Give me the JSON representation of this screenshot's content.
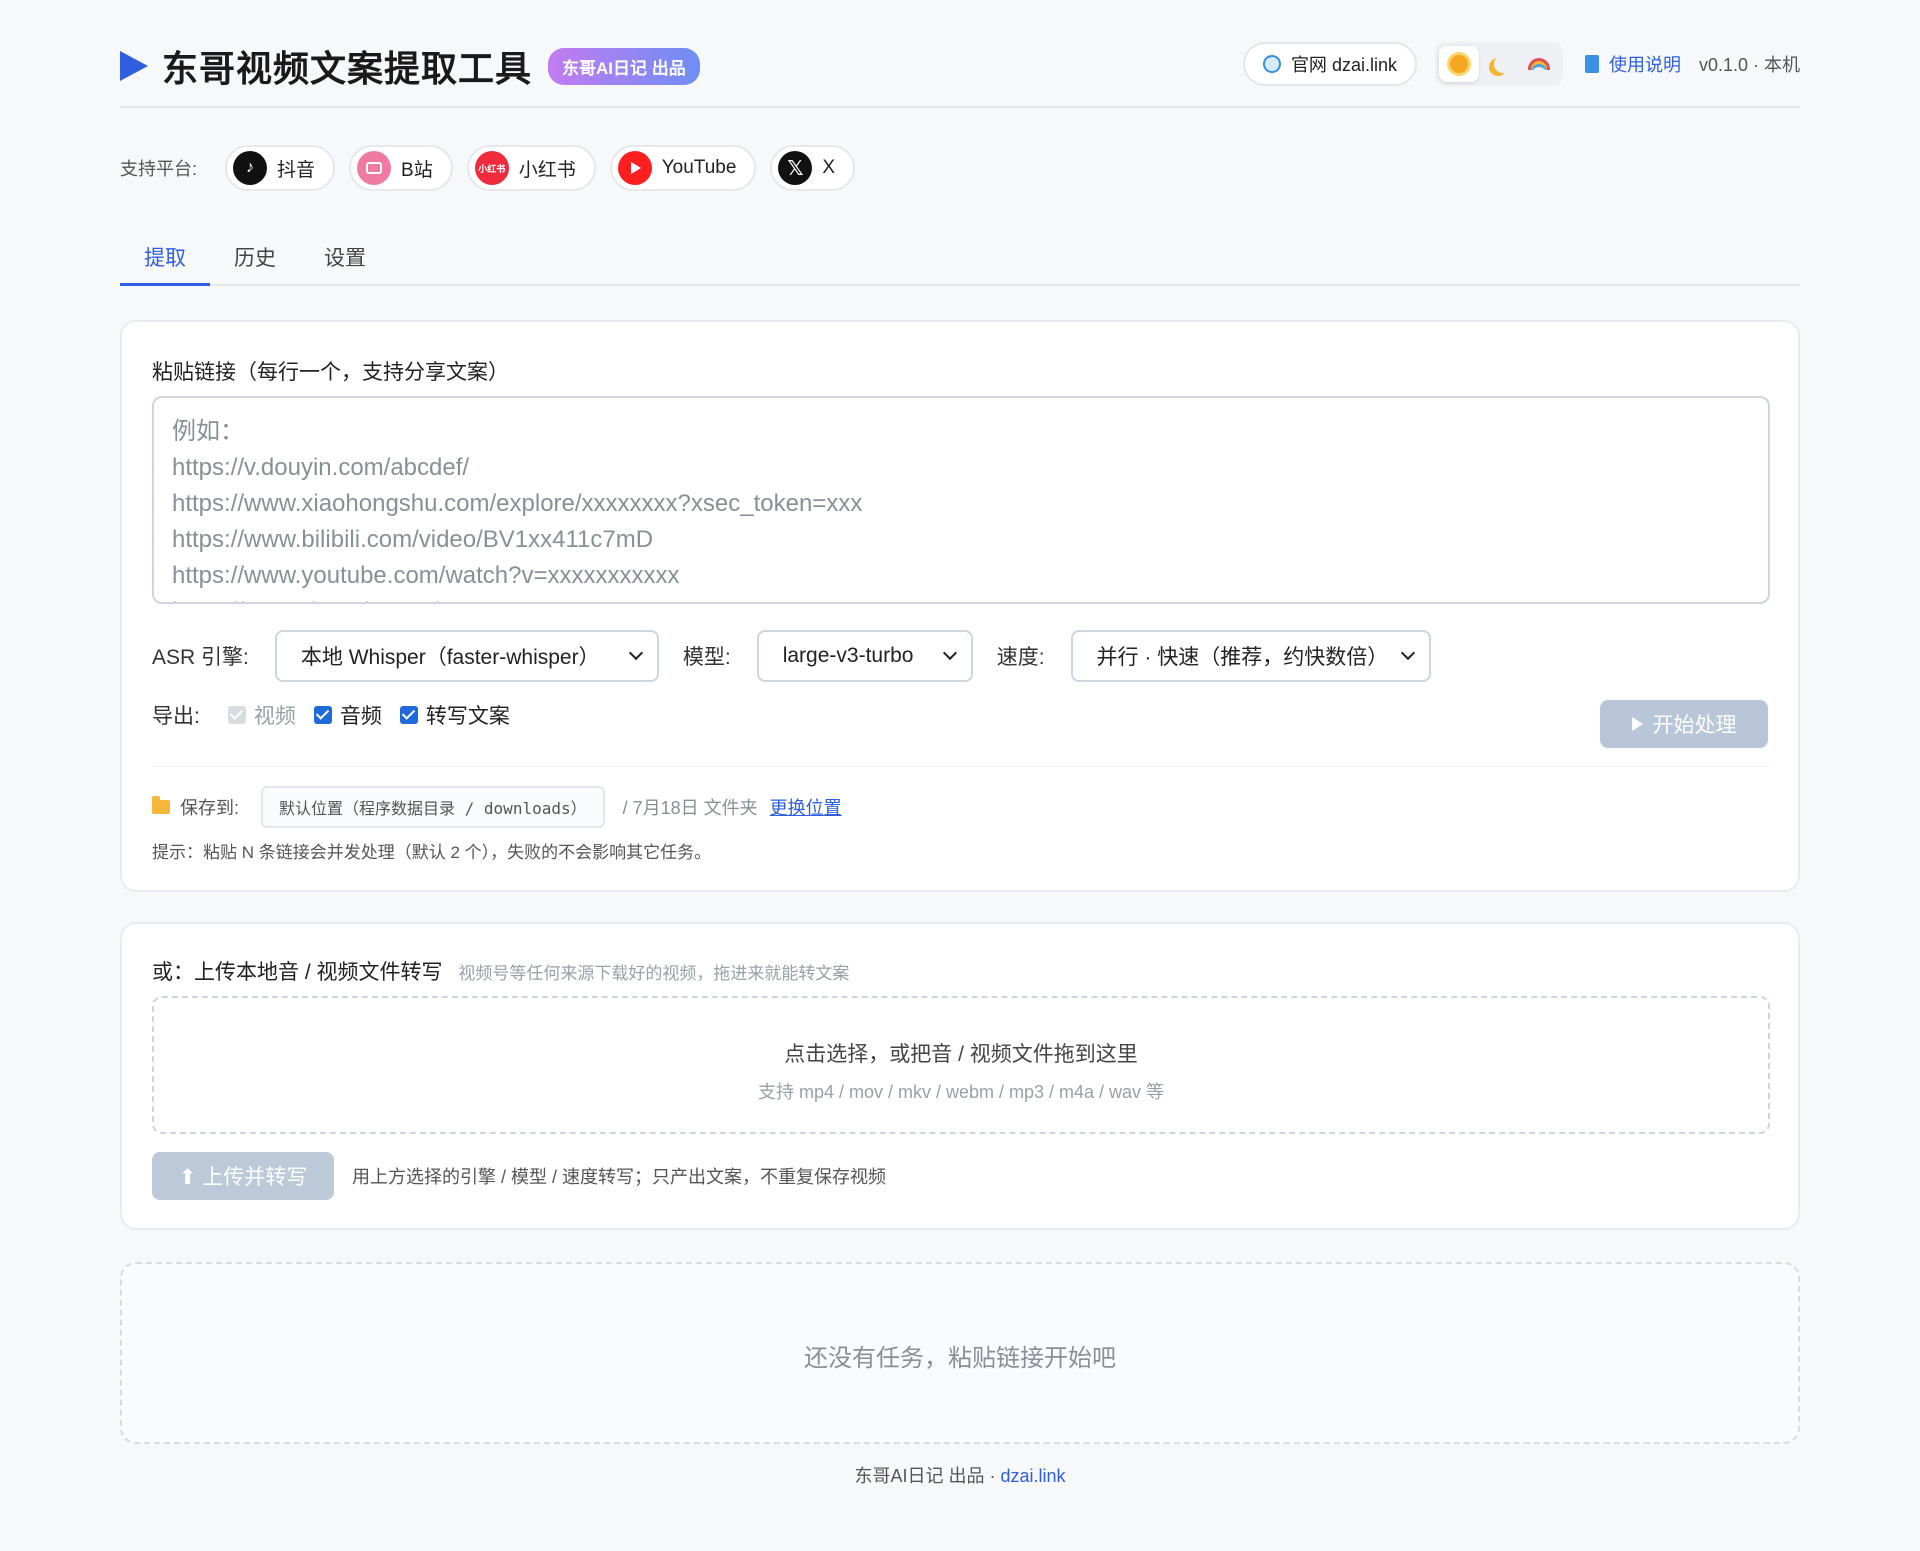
{
  "header": {
    "title": "东哥视频文案提取工具",
    "badge": "东哥AI日记 出品",
    "site_link": "官网 dzai.link",
    "doc_link": "使用说明",
    "version": "v0.1.0 · 本机",
    "theme_icons": [
      "sun-icon",
      "moon-icon",
      "rainbow-icon"
    ]
  },
  "platforms": {
    "label": "支持平台:",
    "items": [
      {
        "name": "抖音",
        "icon": "douyin-icon"
      },
      {
        "name": "B站",
        "icon": "bilibili-icon"
      },
      {
        "name": "小红书",
        "icon": "xiaohongshu-icon",
        "icon_text": "小红书"
      },
      {
        "name": "YouTube",
        "icon": "youtube-icon"
      },
      {
        "name": "X",
        "icon": "x-icon",
        "icon_text": "𝕏"
      }
    ]
  },
  "tabs": [
    "提取",
    "历史",
    "设置"
  ],
  "extract": {
    "title": "粘贴链接（每行一个，支持分享文案）",
    "placeholder": "例如：\nhttps://v.douyin.com/abcdef/\nhttps://www.xiaohongshu.com/explore/xxxxxxxx?xsec_token=xxx\nhttps://www.bilibili.com/video/BV1xx411c7mD\nhttps://www.youtube.com/watch?v=xxxxxxxxxxx\nhttps://x.com/user/status/xxx",
    "asr_label": "ASR 引擎:",
    "asr_value": "本地 Whisper（faster-whisper）",
    "model_label": "模型:",
    "model_value": "large-v3-turbo",
    "speed_label": "速度:",
    "speed_value": "并行 · 快速（推荐，约快数倍）",
    "export_label": "导出:",
    "export_video": "视频",
    "export_audio": "音频",
    "export_text": "转写文案",
    "start_button": "开始处理",
    "save_label": "保存到:",
    "save_path": "默认位置（程序数据目录 / downloads）",
    "save_sub": "/ 7月18日 文件夹",
    "change_location": "更换位置",
    "tip": "提示：粘贴 N 条链接会并发处理（默认 2 个），失败的不会影响其它任务。"
  },
  "upload": {
    "title": "或：上传本地音 / 视频文件转写",
    "subtitle": "视频号等任何来源下载好的视频，拖进来就能转文案",
    "drop_title": "点击选择，或把音 / 视频文件拖到这里",
    "drop_formats": "支持 mp4 / mov / mkv / webm / mp3 / m4a / wav 等",
    "button": "⬆ 上传并转写",
    "note": "用上方选择的引擎 / 模型 / 速度转写；只产出文案，不重复保存视频"
  },
  "tasks": {
    "empty": "还没有任务，粘贴链接开始吧"
  },
  "footer": {
    "text": "东哥AI日记 出品 · ",
    "link": "dzai.link"
  }
}
